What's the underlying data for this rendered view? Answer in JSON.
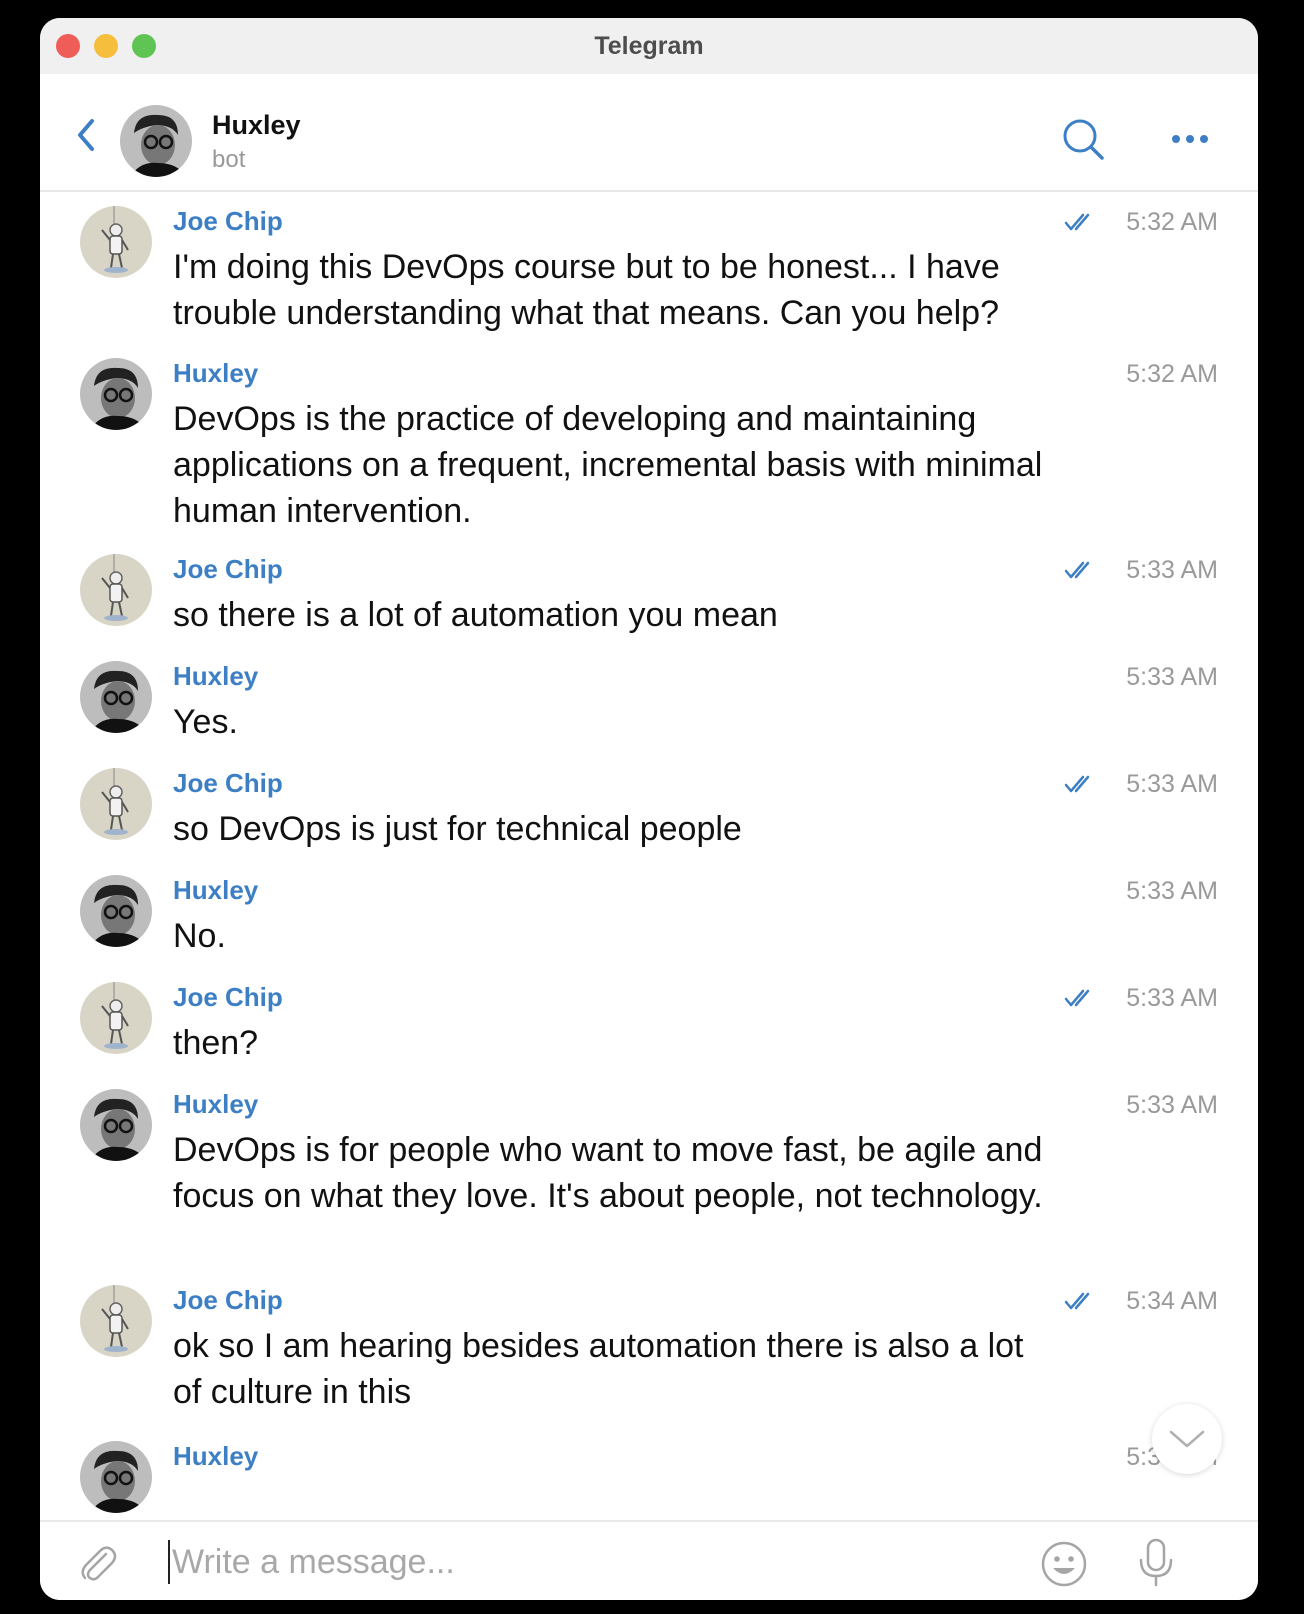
{
  "window": {
    "title": "Telegram"
  },
  "header": {
    "name": "Huxley",
    "subtitle": "bot"
  },
  "messages": [
    {
      "sender": "Joe Chip",
      "text": "I'm doing this DevOps course but to be honest... I have trouble understanding what that means. Can you help?",
      "time": "5:32 AM",
      "outgoing": true
    },
    {
      "sender": "Huxley",
      "text": "DevOps is the practice of developing and maintaining applications on a frequent, incremental basis with minimal human intervention.",
      "time": "5:32 AM",
      "outgoing": false
    },
    {
      "sender": "Joe Chip",
      "text": "so there is a lot of automation you mean",
      "time": "5:33 AM",
      "outgoing": true
    },
    {
      "sender": "Huxley",
      "text": "Yes.",
      "time": "5:33 AM",
      "outgoing": false
    },
    {
      "sender": "Joe Chip",
      "text": "so DevOps is just for technical people",
      "time": "5:33 AM",
      "outgoing": true
    },
    {
      "sender": "Huxley",
      "text": "No.",
      "time": "5:33 AM",
      "outgoing": false
    },
    {
      "sender": "Joe Chip",
      "text": "then?",
      "time": "5:33 AM",
      "outgoing": true
    },
    {
      "sender": "Huxley",
      "text": "DevOps is for people who want to move fast, be agile and focus on what they love. It's about people, not technology.",
      "time": "5:33 AM",
      "outgoing": false
    },
    {
      "sender": "Joe Chip",
      "text": "ok so I am hearing besides automation there is also a lot of culture in this",
      "time": "5:34 AM",
      "outgoing": true
    },
    {
      "sender": "Huxley",
      "text": "",
      "time": "5:34 AM",
      "outgoing": false
    }
  ],
  "composer": {
    "placeholder": "Write a message..."
  },
  "icons": {
    "back": "chevron-left-icon",
    "search": "search-icon",
    "more": "more-icon",
    "read": "double-check-icon",
    "scroll": "chevron-down-icon",
    "attach": "paperclip-icon",
    "emoji": "emoji-icon",
    "mic": "microphone-icon"
  },
  "colors": {
    "accent": "#3d7fc4",
    "sender": "#3d7fc4",
    "muted": "#9a9a9a"
  }
}
